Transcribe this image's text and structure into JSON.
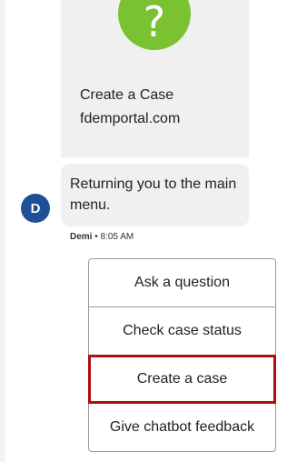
{
  "card": {
    "icon": "question-mark-icon",
    "title": "Create a Case",
    "url": "fdemportal.com"
  },
  "message": {
    "text": "Returning you to the main menu.",
    "avatar_initial": "D",
    "sender": "Demi",
    "separator": " • ",
    "time": "8:05 AM"
  },
  "options": [
    {
      "label": "Ask a question"
    },
    {
      "label": "Check case status"
    },
    {
      "label": "Create a case"
    },
    {
      "label": "Give chatbot feedback"
    }
  ],
  "colors": {
    "icon_green": "#7ac231",
    "avatar_blue": "#1f4f96",
    "highlight_red": "#b00f0f",
    "bubble_gray": "#f0f0f0"
  }
}
